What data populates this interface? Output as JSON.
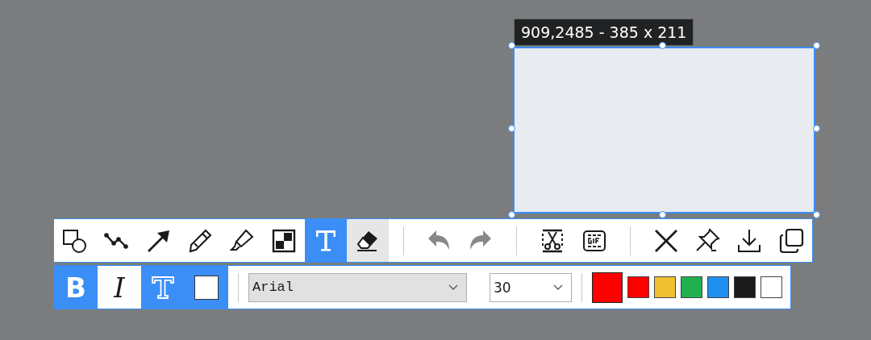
{
  "selection": {
    "tooltip": "909,2485 - 385 x 211"
  },
  "toolbar": {
    "groups": [
      [
        {
          "kind": "shape",
          "selected": false,
          "hovered": false
        },
        {
          "kind": "polyline",
          "selected": false,
          "hovered": false
        },
        {
          "kind": "arrow",
          "selected": false,
          "hovered": false
        },
        {
          "kind": "pencil",
          "selected": false,
          "hovered": false
        },
        {
          "kind": "marker",
          "selected": false,
          "hovered": false
        },
        {
          "kind": "mosaic",
          "selected": false,
          "hovered": false
        },
        {
          "kind": "text",
          "selected": true,
          "hovered": false
        },
        {
          "kind": "eraser",
          "selected": false,
          "hovered": true
        }
      ],
      [
        {
          "kind": "undo",
          "disabled": true
        },
        {
          "kind": "redo",
          "disabled": true
        }
      ],
      [
        {
          "kind": "crop"
        },
        {
          "kind": "gif"
        }
      ],
      [
        {
          "kind": "close"
        },
        {
          "kind": "pin"
        },
        {
          "kind": "save"
        },
        {
          "kind": "copy"
        }
      ]
    ]
  },
  "format": {
    "styles": [
      {
        "kind": "bold",
        "label": "B",
        "selected": true
      },
      {
        "kind": "italic",
        "label": "I",
        "selected": false
      },
      {
        "kind": "outline",
        "selected": true
      },
      {
        "kind": "fill",
        "selected": true
      }
    ],
    "font": {
      "value": "Arial"
    },
    "size": {
      "value": "30"
    },
    "current_color": {
      "color": "#ff0000"
    },
    "palette": [
      {
        "color": "#ff0000"
      },
      {
        "color": "#f0c030"
      },
      {
        "color": "#20b050"
      },
      {
        "color": "#2090f0"
      },
      {
        "color": "#1a1a1a"
      },
      {
        "color": "#ffffff"
      }
    ]
  }
}
